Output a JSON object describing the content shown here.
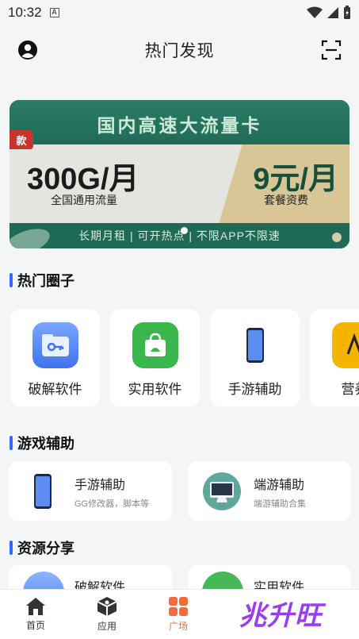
{
  "status": {
    "time": "10:32",
    "badge": "A"
  },
  "header": {
    "title": "热门发现"
  },
  "banner": {
    "headline": "国内高速大流量卡",
    "tag": "款",
    "price_left": "300G/月",
    "sub_left": "全国通用流量",
    "price_right": "9元/月",
    "sub_right": "套餐资费",
    "footer": "长期月租 | 可开热点 | 不限APP不限速"
  },
  "sections": {
    "hot_circles": "热门圈子",
    "game_assist": "游戏辅助",
    "resource_share": "资源分享"
  },
  "circles": [
    {
      "label": "破解软件",
      "icon": "folder-key-icon",
      "color": "#4f86f7"
    },
    {
      "label": "实用软件",
      "icon": "shopping-bag-icon",
      "color": "#3cbc4f"
    },
    {
      "label": "手游辅助",
      "icon": "phone-icon",
      "color": "#ffffff"
    },
    {
      "label": "营养",
      "icon": "book-icon",
      "color": "#f5b400"
    }
  ],
  "games": [
    {
      "title": "手游辅助",
      "sub": "GG修改器，脚本等",
      "icon": "phone-icon"
    },
    {
      "title": "端游辅助",
      "sub": "端游辅助合集",
      "icon": "monitor-icon"
    }
  ],
  "resources": [
    {
      "title": "破解软件",
      "icon": "folder-icon"
    },
    {
      "title": "实用软件",
      "icon": "bag-icon"
    }
  ],
  "nav": [
    {
      "label": "首页",
      "icon": "home-icon"
    },
    {
      "label": "应用",
      "icon": "box-icon"
    },
    {
      "label": "广场",
      "icon": "grid-icon",
      "active": true
    }
  ],
  "watermark": "兆升旺",
  "colors": {
    "accent": "#f26b3a",
    "section_bar": "#2d6cff",
    "banner_green": "#1f6a57"
  }
}
